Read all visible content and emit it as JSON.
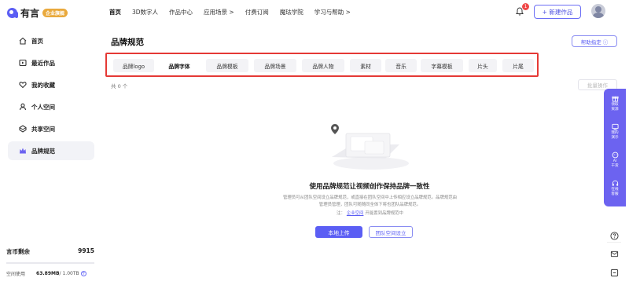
{
  "app": {
    "logo_text": "有言",
    "logo_badge": "企业旗舰"
  },
  "nav": {
    "items": [
      {
        "label": "首页",
        "active": true
      },
      {
        "label": "3D数字人"
      },
      {
        "label": "作品中心"
      },
      {
        "label": "应用场景 >"
      },
      {
        "label": "付费订阅"
      },
      {
        "label": "魔珐学院"
      },
      {
        "label": "学习与帮助 >"
      }
    ],
    "notification_count": "1",
    "new_work_label": "+ 新建作品"
  },
  "sidebar": {
    "items": [
      {
        "label": "首页",
        "icon": "home-icon"
      },
      {
        "label": "最近作品",
        "icon": "recent-icon"
      },
      {
        "label": "我的收藏",
        "icon": "heart-icon"
      },
      {
        "label": "个人空间",
        "icon": "user-icon"
      },
      {
        "label": "共享空间",
        "icon": "shared-icon"
      },
      {
        "label": "品牌规范",
        "icon": "brand-icon",
        "active": true
      }
    ],
    "coins_label": "言币剩余",
    "coins_value": "9915",
    "storage_label": "空间使用",
    "storage_used": "63.89MB",
    "storage_total": "/ 1.00TB"
  },
  "main": {
    "title": "品牌规范",
    "guide_label": "帮助指定 ⓘ",
    "tabs": [
      {
        "label": "品牌logo"
      },
      {
        "label": "品牌字体",
        "active": true
      },
      {
        "label": "品牌模板"
      },
      {
        "label": "品牌场景"
      },
      {
        "label": "品牌人物"
      },
      {
        "label": "素材"
      },
      {
        "label": "音乐"
      },
      {
        "label": "字幕模板"
      },
      {
        "label": "片头"
      },
      {
        "label": "片尾"
      }
    ],
    "count_text": "共 0 个",
    "batch_label": "批量操作",
    "empty_title": "使用品牌规范让视频创作保持品牌一致性",
    "empty_desc": "管理员可从团队空间设立品牌规范，或直接在团队空间中上传相应设立品牌规范。品牌规范由管理员管理，团队可随随同全体下将也团队品牌规范。",
    "empty_note_prefix": "注：",
    "empty_note_link": "企业空间",
    "empty_note_suffix": "开能置到品牌规范中",
    "upload_label": "本地上传",
    "team_label": "团队空间设立"
  },
  "float_panel": {
    "items": [
      {
        "label": "领取\n资源",
        "icon": "gift-icon"
      },
      {
        "label": "我的\n演示",
        "icon": "demo-icon"
      },
      {
        "label": "AI\n干货",
        "icon": "ai-icon"
      },
      {
        "label": "在线\n客服",
        "icon": "headset-icon"
      }
    ]
  },
  "colors": {
    "accent": "#5b5ef4",
    "highlight_border": "#e53935",
    "float_panel": "#6c63f0"
  }
}
